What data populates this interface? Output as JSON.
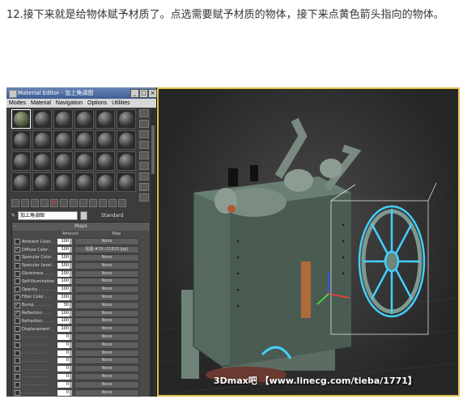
{
  "caption": "12.接下来就是给物体赋予材质了。点选需要赋予材质的物体，接下来点黄色箭头指向的物体。",
  "material_editor": {
    "title": "Material Editor - 加上角调图",
    "menu": [
      "Modes",
      "Material",
      "Navigation",
      "Options",
      "Utilities"
    ],
    "material_name": "加上角调图",
    "material_type": "Standard",
    "maps_title": "Maps",
    "columns": {
      "amount": "Amount",
      "map": "Map"
    },
    "rows": [
      {
        "label": "Ambient Color . .",
        "amount": "100",
        "map": "None",
        "checked": false
      },
      {
        "label": "Diffuse Color . . .",
        "amount": "100",
        "map": "贴图 #39 (21833.jpg)",
        "checked": true
      },
      {
        "label": "Specular Color . .",
        "amount": "100",
        "map": "None",
        "checked": false
      },
      {
        "label": "Specular Level . .",
        "amount": "100",
        "map": "None",
        "checked": false
      },
      {
        "label": "Glossiness . . . .",
        "amount": "100",
        "map": "None",
        "checked": false
      },
      {
        "label": "Self-Illumination .",
        "amount": "100",
        "map": "None",
        "checked": false
      },
      {
        "label": "Opacity . . . . . .",
        "amount": "100",
        "map": "None",
        "checked": false
      },
      {
        "label": "Filter Color . . .",
        "amount": "100",
        "map": "None",
        "checked": false
      },
      {
        "label": "Bump . . . . . . .",
        "amount": "30",
        "map": "None",
        "checked": true
      },
      {
        "label": "Reflection . . . .",
        "amount": "100",
        "map": "None",
        "checked": true
      },
      {
        "label": "Refraction . . . .",
        "amount": "100",
        "map": "None",
        "checked": false
      },
      {
        "label": "Displacement . . .",
        "amount": "100",
        "map": "None",
        "checked": false
      },
      {
        "label": ". . . . . . . . . .",
        "amount": "0",
        "map": "None",
        "checked": false
      },
      {
        "label": ". . . . . . . . . .",
        "amount": "0",
        "map": "None",
        "checked": false
      },
      {
        "label": ". . . . . . . . . .",
        "amount": "0",
        "map": "None",
        "checked": false
      },
      {
        "label": ". . . . . . . . . .",
        "amount": "0",
        "map": "None",
        "checked": false
      },
      {
        "label": ". . . . . . . . . .",
        "amount": "0",
        "map": "None",
        "checked": false
      },
      {
        "label": ". . . . . . . . . .",
        "amount": "0",
        "map": "None",
        "checked": false
      },
      {
        "label": ". . . . . . . . . .",
        "amount": "0",
        "map": "None",
        "checked": false
      },
      {
        "label": ". . . . . . . . . .",
        "amount": "0",
        "map": "None",
        "checked": false
      }
    ]
  },
  "viewport": {
    "watermark": "3Dmax吧 【www.linecg.com/tieba/1771】"
  }
}
